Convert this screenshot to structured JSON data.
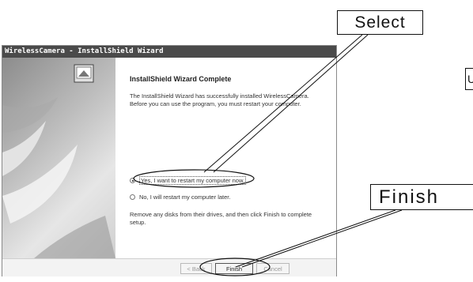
{
  "window": {
    "title": "WirelessCamera - InstallShield Wizard"
  },
  "content": {
    "heading": "InstallShield Wizard Complete",
    "description": "The InstallShield Wizard has successfully installed WirelessCamera.  Before you can use the program, you must restart your computer.",
    "options": [
      {
        "label": "Yes, I want to restart my computer now.",
        "selected": true
      },
      {
        "label": "No, I will restart my computer later.",
        "selected": false
      }
    ],
    "footer_note": "Remove any disks from their drives, and then click Finish to complete setup."
  },
  "buttons": {
    "back": "< Back",
    "finish": "Finish",
    "cancel": "Cancel"
  },
  "callouts": {
    "select": "Select",
    "finish": "Finish",
    "partial": "U"
  }
}
